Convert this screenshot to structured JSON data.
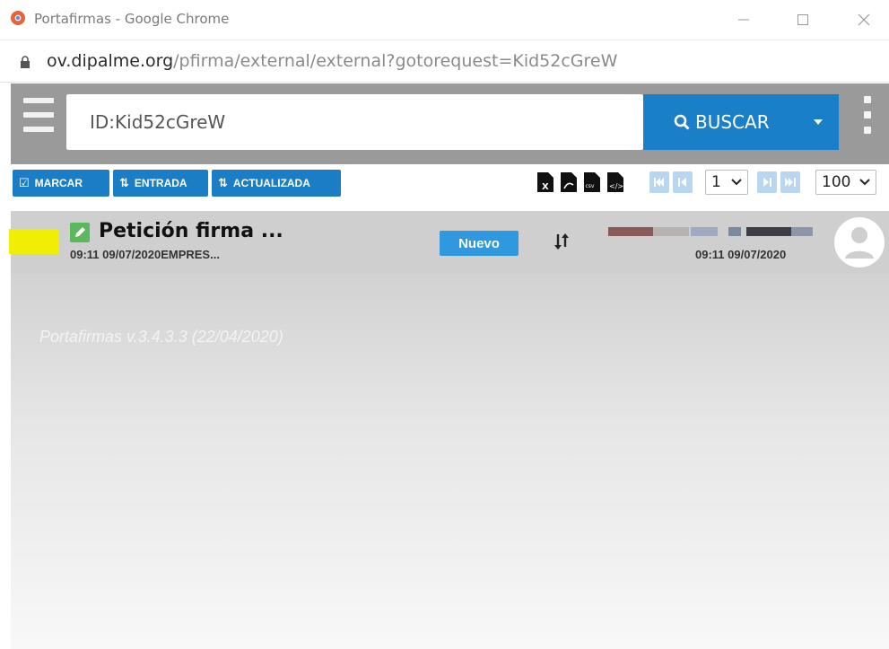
{
  "window": {
    "title": "Portafirmas - Google Chrome"
  },
  "address": {
    "host": "ov.dipalme.org",
    "path": "/pfirma/external/external?gotorequest=Kid52cGreW"
  },
  "search": {
    "value": "ID:Kid52cGreW",
    "button_label": "BUSCAR"
  },
  "toolbar": {
    "marcar_label": "MARCAR",
    "entrada_label": "ENTRADA",
    "actualizada_label": "ACTUALIZADA",
    "export_icons": [
      "excel-file-icon",
      "pdf-file-icon",
      "csv-file-icon",
      "xml-file-icon"
    ],
    "page_value": "1",
    "page_size_value": "100"
  },
  "request": {
    "title": "Petición firma ...",
    "subtitle": "09:11 09/07/2020EMPRES...",
    "status_badge": "Nuevo",
    "date": "09:11 09/07/2020"
  },
  "footer": {
    "version": "Portafirmas v.3.4.3.3 (22/04/2020)"
  },
  "colors": {
    "primary_blue": "#1a7fc9",
    "header_gray": "#9a9a9a",
    "row_gray": "#cfcfcf",
    "badge_blue": "#2f98df",
    "highlight_yellow": "#f1ee06"
  }
}
